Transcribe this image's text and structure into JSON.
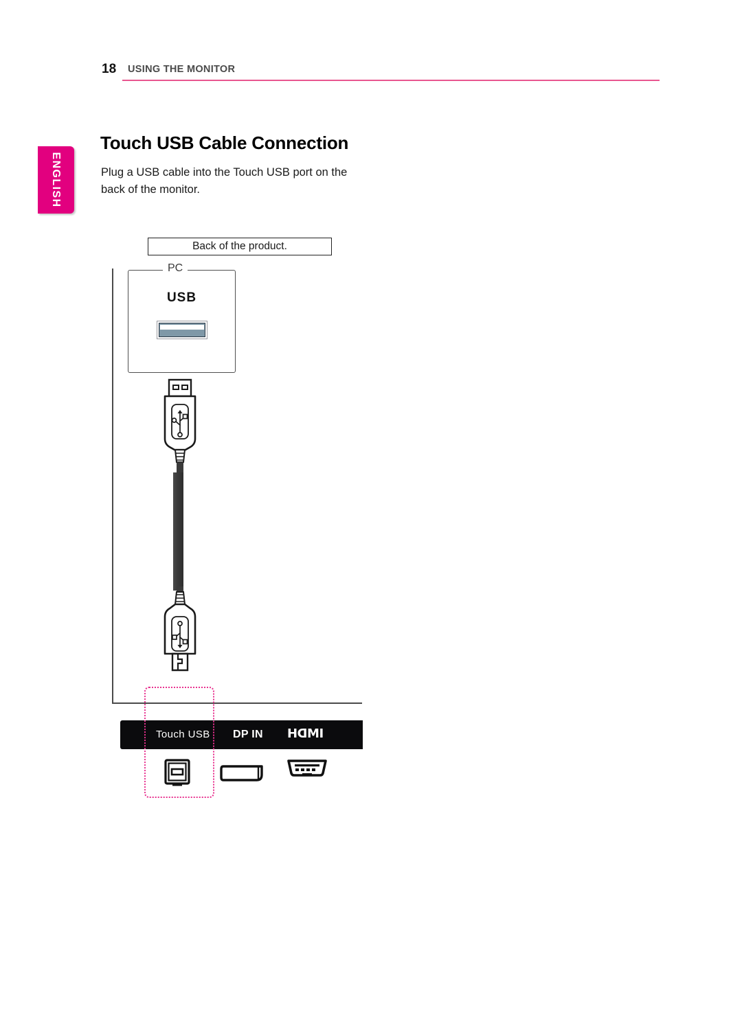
{
  "header": {
    "page_number": "18",
    "title": "USING THE MONITOR",
    "rule_color": "#e8568f"
  },
  "language_tab": {
    "label": "ENGLISH",
    "background_color": "#e2007f",
    "text_color": "#ffffff"
  },
  "section": {
    "title": "Touch USB Cable Connection",
    "body": "Plug a USB cable into the Touch USB port on the back of the monitor."
  },
  "diagram": {
    "caption": "Back of the product.",
    "pc_panel": {
      "legend": "PC",
      "port_label": "USB",
      "port_fill_color": "#7f98a7"
    },
    "cable": {
      "top_connector": "usb-a-connector",
      "bottom_connector": "usb-b-connector",
      "shaft_color": "#3a3a3a"
    },
    "ports_bar": {
      "background_color": "#0b0b0d",
      "labels": [
        {
          "id": "touch-usb",
          "text": "Touch  USB",
          "icon": "usb-b-port-icon"
        },
        {
          "id": "dp-in",
          "text": "DP IN",
          "icon": "displayport-port-icon"
        },
        {
          "id": "hdmi",
          "text": "HDMI",
          "icon": "hdmi-port-icon"
        }
      ]
    },
    "highlight": {
      "target": "touch-usb",
      "style": "dotted",
      "color": "#e8318e"
    }
  }
}
